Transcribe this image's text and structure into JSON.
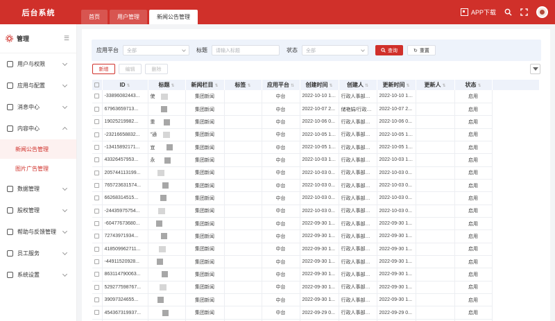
{
  "brand": "后台系统",
  "tabs": [
    {
      "label": "首页",
      "active": false
    },
    {
      "label": "用户管理",
      "active": false
    },
    {
      "label": "新闻公告管理",
      "active": true
    }
  ],
  "topbar": {
    "app_download": "APP下载",
    "icons": [
      "qr-code-icon",
      "search-icon",
      "fullscreen-icon",
      "avatar"
    ],
    "accent": "#d0302a"
  },
  "sidebar": {
    "title": "管理",
    "items": [
      {
        "label": "用户与权限",
        "icon": "user-icon",
        "expanded": false
      },
      {
        "label": "应用与配置",
        "icon": "sliders-icon",
        "expanded": false
      },
      {
        "label": "消息中心",
        "icon": "message-icon",
        "expanded": false
      },
      {
        "label": "内容中心",
        "icon": "content-icon",
        "expanded": true
      },
      {
        "label": "数据管理",
        "icon": "data-icon",
        "expanded": false
      },
      {
        "label": "股权管理",
        "icon": "equity-icon",
        "expanded": false
      },
      {
        "label": "帮助与反馈管理",
        "icon": "help-icon",
        "expanded": false
      },
      {
        "label": "员工服务",
        "icon": "staff-icon",
        "expanded": false
      },
      {
        "label": "系统设置",
        "icon": "settings-icon",
        "expanded": false
      }
    ],
    "sub_items": [
      "新闻公告管理",
      "图片广告管理"
    ]
  },
  "filter": {
    "platform_label": "应用平台",
    "platform_value": "全部",
    "title_label": "标题",
    "title_placeholder": "请输入标题",
    "status_label": "状态",
    "status_value": "全部",
    "search_btn": "查询",
    "reset_btn": "重置"
  },
  "actions": {
    "add": "新增",
    "edit": "编辑",
    "delete": "删除"
  },
  "table": {
    "columns": [
      "ID",
      "标题",
      "新闻栏目",
      "标签",
      "应用平台",
      "创建时间",
      "创建人",
      "更新时间",
      "更新人",
      "状态"
    ],
    "rows": [
      {
        "id": "-33896082443...",
        "title": "使",
        "column": "集团新闻",
        "tag": "",
        "platform": "中台",
        "created": "2022-10-10 14...",
        "creator": "行政人事部行政...",
        "updated": "2022-10-10 14...",
        "updater": "",
        "status": "启用"
      },
      {
        "id": "67963659713...",
        "title": "",
        "column": "集团新闻",
        "tag": "",
        "platform": "中台",
        "created": "2022-10-07 2...",
        "creator": "储艳娟/行政人...",
        "updated": "2022-10-07 2...",
        "updater": "",
        "status": "启用"
      },
      {
        "id": "19025219982...",
        "title": "重",
        "column": "集团新闻",
        "tag": "",
        "platform": "中台",
        "created": "2022-10-06 0...",
        "creator": "行政人事部行政...",
        "updated": "2022-10-06 0...",
        "updater": "",
        "status": "启用"
      },
      {
        "id": "-23216658832...",
        "title": "\"通",
        "column": "集团新闻",
        "tag": "",
        "platform": "中台",
        "created": "2022-10-05 16...",
        "creator": "行政人事部行政...",
        "updated": "2022-10-05 16...",
        "updater": "",
        "status": "启用"
      },
      {
        "id": "-13415892171...",
        "title": "宜",
        "column": "集团新闻",
        "tag": "",
        "platform": "中台",
        "created": "2022-10-05 16...",
        "creator": "行政人事部行政...",
        "updated": "2022-10-05 16...",
        "updater": "",
        "status": "启用"
      },
      {
        "id": "43326457953...",
        "title": "永",
        "column": "集团新闻",
        "tag": "",
        "platform": "中台",
        "created": "2022-10-03 10...",
        "creator": "行政人事部行政...",
        "updated": "2022-10-03 10...",
        "updater": "",
        "status": "启用"
      },
      {
        "id": "205744113199...",
        "title": "",
        "column": "集团新闻",
        "tag": "",
        "platform": "中台",
        "created": "2022-10-03 0...",
        "creator": "行政人事部行政...",
        "updated": "2022-10-03 0...",
        "updater": "",
        "status": "启用"
      },
      {
        "id": "765723631574...",
        "title": "",
        "column": "集团新闻",
        "tag": "",
        "platform": "中台",
        "created": "2022-10-03 0...",
        "creator": "行政人事部行政...",
        "updated": "2022-10-03 0...",
        "updater": "",
        "status": "启用"
      },
      {
        "id": "66268314515...",
        "title": "",
        "column": "集团新闻",
        "tag": "",
        "platform": "中台",
        "created": "2022-10-03 0...",
        "creator": "行政人事部行政...",
        "updated": "2022-10-03 0...",
        "updater": "",
        "status": "启用"
      },
      {
        "id": "-24435975754...",
        "title": "",
        "column": "集团新闻",
        "tag": "",
        "platform": "中台",
        "created": "2022-10-03 0...",
        "creator": "行政人事部行政...",
        "updated": "2022-10-03 0...",
        "updater": "",
        "status": "启用"
      },
      {
        "id": "-60477673680...",
        "title": "",
        "column": "集团新闻",
        "tag": "",
        "platform": "中台",
        "created": "2022-09-30 1...",
        "creator": "行政人事部行政...",
        "updated": "2022-09-30 1...",
        "updater": "",
        "status": "启用"
      },
      {
        "id": "72743971934...",
        "title": "",
        "column": "集团新闻",
        "tag": "",
        "platform": "中台",
        "created": "2022-09-30 1...",
        "creator": "行政人事部行政...",
        "updated": "2022-09-30 1...",
        "updater": "",
        "status": "启用"
      },
      {
        "id": "418509962711...",
        "title": "",
        "column": "集团新闻",
        "tag": "",
        "platform": "中台",
        "created": "2022-09-30 1...",
        "creator": "行政人事部行政...",
        "updated": "2022-09-30 1...",
        "updater": "",
        "status": "启用"
      },
      {
        "id": "-44911520928...",
        "title": "",
        "column": "集团新闻",
        "tag": "",
        "platform": "中台",
        "created": "2022-09-30 1...",
        "creator": "行政人事部行政...",
        "updated": "2022-09-30 1...",
        "updater": "",
        "status": "启用"
      },
      {
        "id": "863114790063...",
        "title": "",
        "column": "集团新闻",
        "tag": "",
        "platform": "中台",
        "created": "2022-09-30 1...",
        "creator": "行政人事部行政...",
        "updated": "2022-09-30 1...",
        "updater": "",
        "status": "启用"
      },
      {
        "id": "529277598767...",
        "title": "",
        "column": "集团新闻",
        "tag": "",
        "platform": "中台",
        "created": "2022-09-30 1...",
        "creator": "行政人事部行政...",
        "updated": "2022-09-30 1...",
        "updater": "",
        "status": "启用"
      },
      {
        "id": "39097324655...",
        "title": "",
        "column": "集团新闻",
        "tag": "",
        "platform": "中台",
        "created": "2022-09-30 1...",
        "creator": "行政人事部行政...",
        "updated": "2022-09-30 1...",
        "updater": "",
        "status": "启用"
      },
      {
        "id": "454367319937...",
        "title": "",
        "column": "集团新闻",
        "tag": "",
        "platform": "中台",
        "created": "2022-09-29 0...",
        "creator": "行政人事部行政...",
        "updated": "2022-09-29 0...",
        "updater": "",
        "status": "启用"
      },
      {
        "id": "762611062823...",
        "title": "",
        "column": "集团新闻",
        "tag": "",
        "platform": "中台",
        "created": "2022-09-29 0...",
        "creator": "行政人事部行政...",
        "updated": "2022-09-29 0...",
        "updater": "",
        "status": "启用"
      }
    ]
  }
}
